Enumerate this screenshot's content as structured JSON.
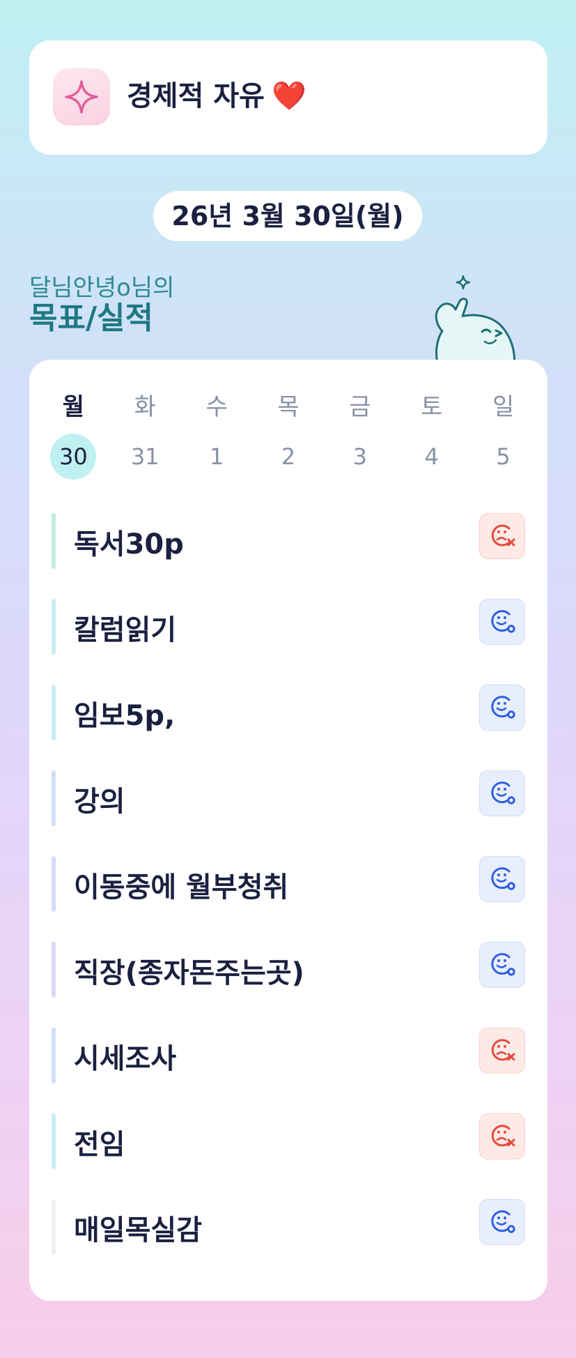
{
  "goal_card": {
    "title": "경제적 자유",
    "heart": "❤️",
    "icon": "sparkle-icon"
  },
  "date_label": "26년 3월 30일(월)",
  "owner": {
    "line": "달님안녕o님의",
    "title": "목표/실적"
  },
  "week": [
    {
      "day": "월",
      "date": "30",
      "active": true
    },
    {
      "day": "화",
      "date": "31",
      "active": false
    },
    {
      "day": "수",
      "date": "1",
      "active": false
    },
    {
      "day": "목",
      "date": "2",
      "active": false
    },
    {
      "day": "금",
      "date": "3",
      "active": false
    },
    {
      "day": "토",
      "date": "4",
      "active": false
    },
    {
      "day": "일",
      "date": "5",
      "active": false
    }
  ],
  "goals": [
    {
      "label": "독서30p",
      "status": "fail",
      "bar_color": "#bfeede"
    },
    {
      "label": "칼럼읽기",
      "status": "pass",
      "bar_color": "#c8ecf3"
    },
    {
      "label": "임보5p,",
      "status": "pass",
      "bar_color": "#c8ecf3"
    },
    {
      "label": "강의",
      "status": "pass",
      "bar_color": "#d3defa"
    },
    {
      "label": "이동중에 월부청취",
      "status": "pass",
      "bar_color": "#d6dcfa"
    },
    {
      "label": "직장(종자돈주는곳)",
      "status": "pass",
      "bar_color": "#ddd8fa"
    },
    {
      "label": "시세조사",
      "status": "fail",
      "bar_color": "#d3defa"
    },
    {
      "label": "전임",
      "status": "fail",
      "bar_color": "#c8ecf3"
    },
    {
      "label": "매일목실감",
      "status": "pass",
      "bar_color": "#eef0f4"
    }
  ],
  "colors": {
    "fail": "#e64a3b",
    "pass": "#2f5fe0",
    "active_day": "#bff0f2"
  }
}
